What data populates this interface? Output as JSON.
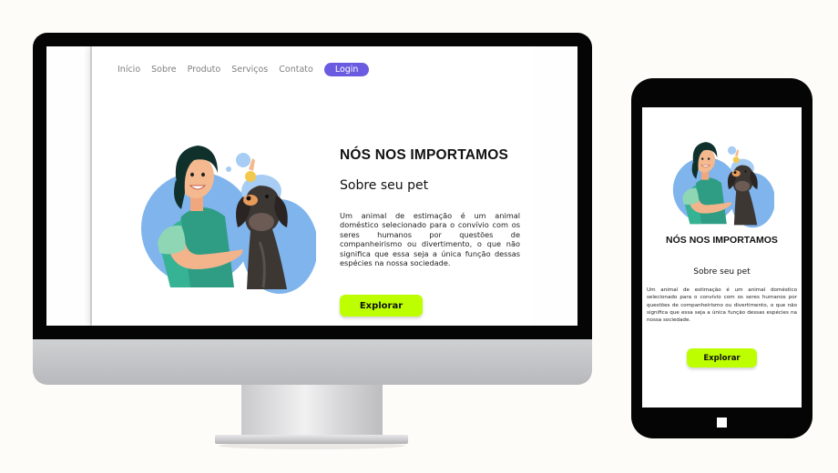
{
  "nav": {
    "items": [
      "Início",
      "Sobre",
      "Produto",
      "Serviços",
      "Contato"
    ],
    "login_label": "Login"
  },
  "hero": {
    "title": "NÓS NOS IMPORTAMOS",
    "subtitle": "Sobre seu pet",
    "text": "Um animal de estimação é um animal doméstico selecionado para o convívio com os seres humanos por questões de companheirismo ou divertimento, o que não significa que essa seja a única função dessas espécies na nossa sociedade.",
    "button_label": "Explorar"
  },
  "mobile": {
    "title": "NÓS NOS IMPORTAMOS",
    "subtitle": "Sobre seu pet",
    "text": "Um animal de estimação é um animal doméstico selecionado para o convívio com os seres humanos por questões de companheirismo ou divertimento, o que não significa que essa seja a única função dessas espécies na nossa sociedade.",
    "button_label": "Explorar"
  },
  "icons": {
    "illustration": "woman-with-dog-illustration",
    "phone_home": "home-button-icon"
  },
  "colors": {
    "accent_button": "#bdff00",
    "login_button": "#6a5be0",
    "device_frame": "#050505"
  }
}
